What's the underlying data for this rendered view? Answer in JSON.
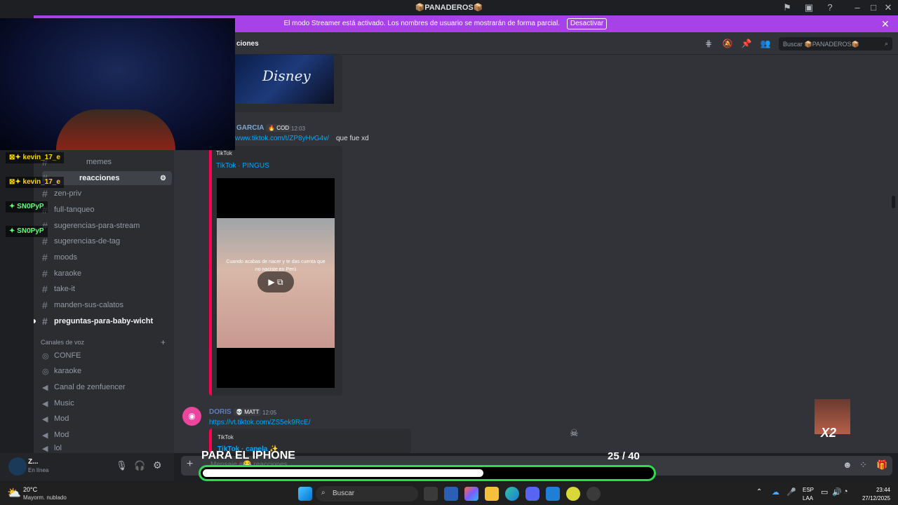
{
  "window": {
    "title": "📦PANADEROS📦"
  },
  "banner": {
    "message": "El modo Streamer está activado. Los nombres de usuario se mostrarán de forma parcial.",
    "button": "Desactivar"
  },
  "header": {
    "channel_name": "ciones",
    "search_placeholder": "Buscar 📦PANADEROS📦"
  },
  "sidebar": {
    "text_channels": [
      {
        "name": "memes"
      },
      {
        "name": "reacciones"
      },
      {
        "name": "zen-priv"
      },
      {
        "name": "full-tanqueo"
      },
      {
        "name": "sugerencias-para-stream"
      },
      {
        "name": "sugerencias-de-tag"
      },
      {
        "name": "moods"
      },
      {
        "name": "karaoke"
      },
      {
        "name": "take-it"
      },
      {
        "name": "manden-sus-calatos"
      },
      {
        "name": "preguntas-para-baby-wicht"
      }
    ],
    "voice_category": "Canales de voz",
    "voice_channels": [
      {
        "name": "CONFE"
      },
      {
        "name": "karaoke"
      },
      {
        "name": "Canal de zenfuencer"
      },
      {
        "name": "Music"
      },
      {
        "name": "Mod"
      },
      {
        "name": "Mod"
      },
      {
        "name": "lol"
      }
    ]
  },
  "messages": [
    {
      "user": "GARCIA",
      "badge": "COD",
      "time": "12:03",
      "link": "www.tiktok.com/t/ZP8yHvG4v/",
      "text": "que fue xd",
      "embed_provider": "TikTok",
      "embed_title": "TikTok · PINGUS",
      "video_caption": "Cuando acabas de nacer y te das cuenta que no naciste en Perú"
    },
    {
      "user": "DORIS",
      "badge": "MATT",
      "time": "12:05",
      "link": "https://vt.tiktok.com/ZS5ek9RcE/",
      "embed_provider": "TikTok",
      "embed_title": "TikTok · canela ✨"
    }
  ],
  "overlay": {
    "voice_users": [
      "kevin_17_e",
      "kevin_17_e",
      "SN0PyP",
      "SN0PyP"
    ],
    "stream_title": "PARA EL IPHONE",
    "counter_current": "25",
    "counter_total": "/ 40",
    "progress": 0.625,
    "multiplier": "X2"
  },
  "user_panel": {
    "name": "Z...",
    "status": "En línea"
  },
  "input": {
    "placeholder": "Mensaje #😂 reacciones"
  },
  "taskbar": {
    "weather_temp": "20°C",
    "weather_desc": "Mayorm. nublado",
    "search": "Buscar",
    "lang": "ESP",
    "lang_sub": "LAA",
    "time": "23:44",
    "date": "27/12/2025"
  },
  "colors": {
    "banner": "#a642e8",
    "progress_border": "#2edc4b",
    "link": "#00a8fc"
  }
}
